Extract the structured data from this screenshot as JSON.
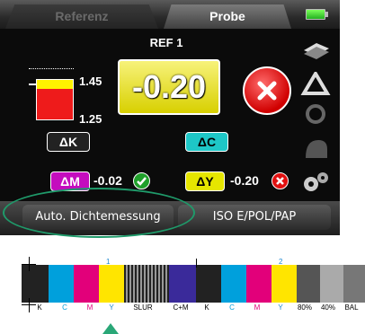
{
  "tabs": {
    "referenz": "Referenz",
    "probe": "Probe"
  },
  "ref_title": "REF 1",
  "scale": {
    "top": "1.45",
    "bottom": "1.25"
  },
  "big_value": "-0.20",
  "delta": {
    "k_label": "ΔK",
    "c_label": "ΔC",
    "m_label": "ΔM",
    "m_value": "-0.02",
    "y_label": "ΔY",
    "y_value": "-0.20"
  },
  "bottom": {
    "left_button": "Auto. Dichtemessung",
    "right_button": "ISO E/POL/PAP"
  },
  "strip": {
    "labels": [
      "K",
      "C",
      "M",
      "Y",
      "SLUR",
      "C+M",
      "K",
      "C",
      "M",
      "Y",
      "80%",
      "40%",
      "BAL"
    ],
    "group_numbers": [
      "1",
      "2"
    ]
  },
  "colors": {
    "cyan": "#00a0dc",
    "magenta": "#e2007a",
    "yellow": "#ffe500",
    "accent_green": "#1f9a6a"
  },
  "icons": [
    "battery-icon",
    "fail-icon",
    "stack-icon",
    "triangle-icon",
    "sync-icon",
    "shape-icon",
    "gears-icon",
    "check-icon"
  ]
}
